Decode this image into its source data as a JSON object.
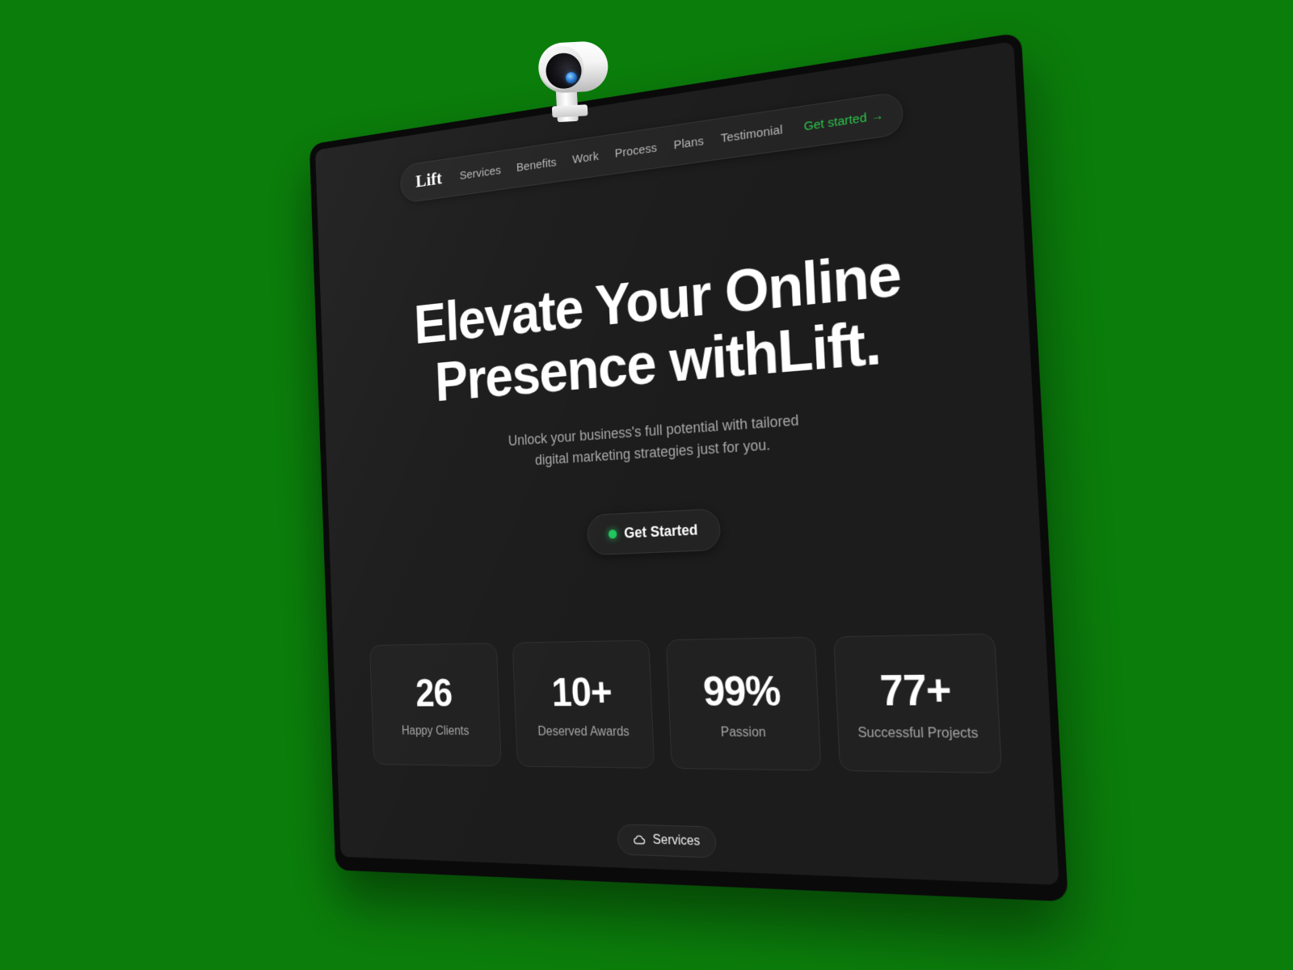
{
  "background": {
    "color": "#0a7d0a"
  },
  "device": {
    "type": "monitor",
    "screen_bg": "#1c1c1c",
    "bezel_color": "#0a0a0a",
    "webcam": {
      "name": "webcam",
      "body_color": "#ffffff",
      "lens_color": "#0a0a0d",
      "glint_color": "#2f7fd6"
    }
  },
  "navbar": {
    "brand": "Lift",
    "links": [
      {
        "label": "Services"
      },
      {
        "label": "Benefits"
      },
      {
        "label": "Work"
      },
      {
        "label": "Process"
      },
      {
        "label": "Plans"
      },
      {
        "label": "Testimonial"
      }
    ],
    "cta": {
      "label": "Get started",
      "arrow": "→",
      "color": "#2bc44a"
    }
  },
  "hero": {
    "title_line1": "Elevate Your Online",
    "title_line2": "Presence withLift.",
    "subtitle_line1": "Unlock your business's full potential with tailored",
    "subtitle_line2": "digital marketing strategies just for you.",
    "cta": {
      "label": "Get Started",
      "dot_color": "#22c55e"
    }
  },
  "stats": [
    {
      "value": "26",
      "label": "Happy Clients"
    },
    {
      "value": "10+",
      "label": "Deserved Awards"
    },
    {
      "value": "99%",
      "label": "Passion"
    },
    {
      "value": "77+",
      "label": "Successful Projects"
    }
  ],
  "services_badge": {
    "label": "Services",
    "icon": "cloud-icon"
  }
}
